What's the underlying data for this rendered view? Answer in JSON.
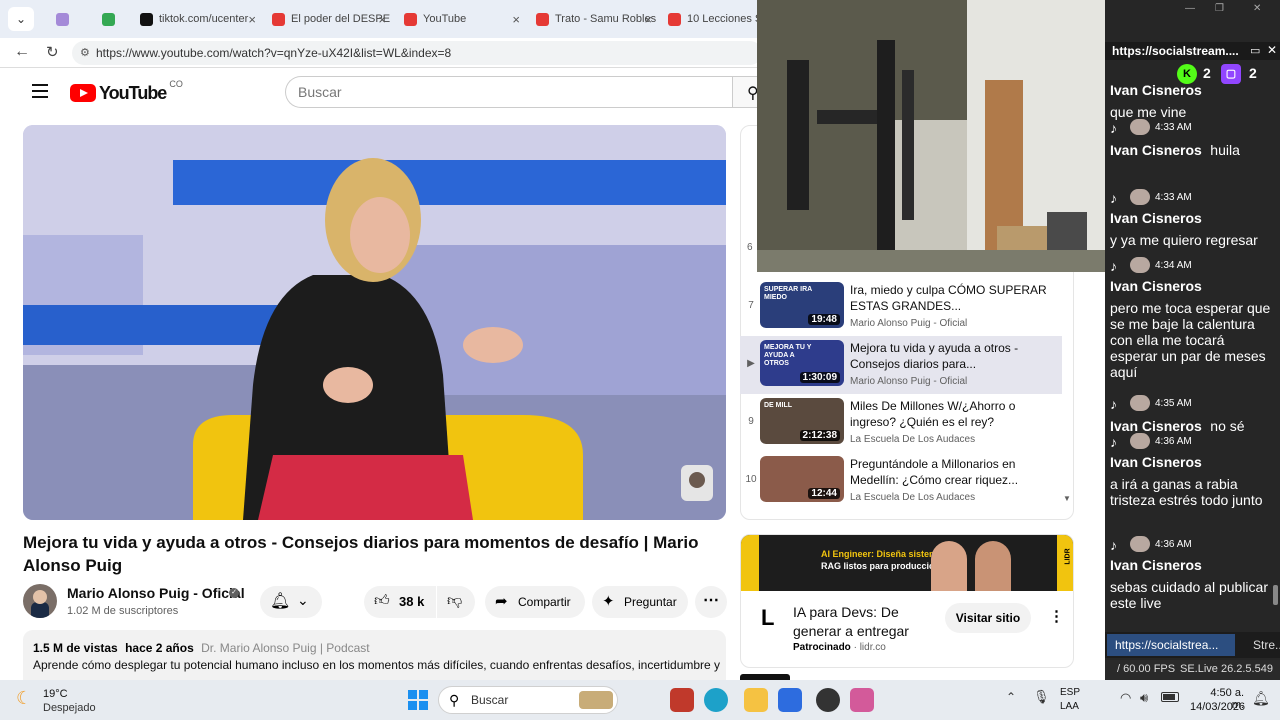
{
  "browser": {
    "tabs": [
      {
        "label": "",
        "color": "#a48ad8"
      },
      {
        "label": "",
        "color": "#34a853"
      },
      {
        "label": "tiktok.com/ucenter",
        "color": "#111111"
      },
      {
        "label": "El poder del DESPE",
        "color": "#e53935"
      },
      {
        "label": "YouTube",
        "color": "#e53935"
      },
      {
        "label": "Trato - Samu Robles",
        "color": "#e53935"
      },
      {
        "label": "10 Lecciones So",
        "color": "#e53935"
      }
    ],
    "url": "https://www.youtube.com/watch?v=qnYze-uX42I&list=WL&index=8"
  },
  "youtube": {
    "logo_text": "YouTube",
    "country": "CO",
    "search_placeholder": "Buscar",
    "video_title": "Mejora tu vida y ayuda a otros - Consejos diarios para momentos de desafío | Mario Alonso Puig",
    "channel_name": "Mario Alonso Puig - Oficial",
    "subscribers": "1.02 M de suscriptores",
    "likes": "38 k",
    "share_label": "Compartir",
    "ask_label": "Preguntar",
    "views": "1.5 M de vistas",
    "age": "hace 2 años",
    "tags": "Dr. Mario Alonso Puig | Podcast",
    "description": "Aprende cómo desplegar tu potencial humano incluso en los momentos más difíciles, cuando enfrentas desafíos, incertidumbre y",
    "playlist_partial": "6",
    "playlist": [
      {
        "index": "7",
        "title": "Ira, miedo y culpa CÓMO SUPERAR ESTAS GRANDES...",
        "channel": "Mario Alonso Puig - Oficial",
        "duration": "19:48",
        "thumb_text": "SUPERAR IRA MIEDO",
        "active": false
      },
      {
        "index": "▶",
        "title": "Mejora tu vida y ayuda a otros - Consejos diarios para...",
        "channel": "Mario Alonso Puig - Oficial",
        "duration": "1:30:09",
        "thumb_text": "MEJORA TU Y AYUDA A OTROS",
        "active": true
      },
      {
        "index": "9",
        "title": "Miles De Millones W/¿Ahorro o ingreso? ¿Quién es el rey?",
        "channel": "La Escuela De Los Audaces",
        "duration": "2:12:38",
        "thumb_text": "DE MILL",
        "active": false
      },
      {
        "index": "10",
        "title": "Preguntándole a Millonarios en Medellín: ¿Cómo crear riquez...",
        "channel": "La Escuela De Los Audaces",
        "duration": "12:44",
        "thumb_text": "",
        "active": false
      }
    ],
    "ad": {
      "banner_line1": "AI Engineer: Diseña sistemas",
      "banner_line2": "RAG listos para producción",
      "banner_brand": "LIDR",
      "title": "IA para Devs: De generar a entregar",
      "sponsored": "Patrocinado",
      "domain": "lidr.co",
      "button": "Visitar sitio"
    }
  },
  "chat": {
    "header_url": "https://socialstream....",
    "kick_count": "2",
    "twitch_count": "2",
    "messages": [
      {
        "time": "",
        "name": "Ivan Cisneros",
        "text": "que me vine",
        "inline": false
      },
      {
        "time": "4:33 AM",
        "name": "Ivan Cisneros",
        "text": "huila",
        "inline": true
      },
      {
        "time": "4:33 AM",
        "name": "Ivan Cisneros",
        "text": "y ya me quiero regresar",
        "inline": false
      },
      {
        "time": "4:34 AM",
        "name": "Ivan Cisneros",
        "text": "pero me toca esperar que se me baje la calentura con ella me tocará esperar un par de meses aquí",
        "inline": false
      },
      {
        "time": "4:35 AM",
        "name": "Ivan Cisneros",
        "text": "no sé",
        "inline": true
      },
      {
        "time": "4:36 AM",
        "name": "Ivan Cisneros",
        "text": "a irá a ganas a rabia tristeza estrés todo junto",
        "inline": false
      },
      {
        "time": "4:36 AM",
        "name": "Ivan Cisneros",
        "text": "sebas cuidado al publicar este live",
        "inline": false
      }
    ],
    "footer_tab1": "https://socialstrea...",
    "footer_tab2": "Stre...",
    "fps": "/ 60.00 FPS",
    "version": "SE.Live 26.2.5.549"
  },
  "taskbar": {
    "temp": "19°C",
    "weather": "Despejado",
    "search": "Buscar",
    "lang1": "ESP",
    "lang2": "LAA",
    "time": "4:50 a. m.",
    "date": "14/03/2026"
  }
}
